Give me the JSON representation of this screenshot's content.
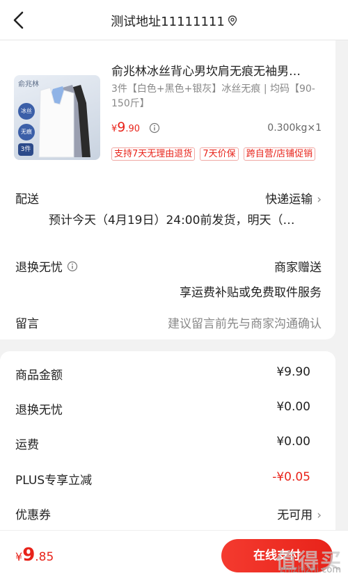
{
  "header": {
    "title": "测试地址11111111",
    "back_icon": "chevron-left-icon",
    "location_icon": "location-pin-icon"
  },
  "product": {
    "title": "俞兆林冰丝背心男坎肩无痕无袖男…",
    "thumb_brand": "俞兆林",
    "thumb_badge1": "冰丝",
    "thumb_badge2": "无痕",
    "thumb_badge3": "3件",
    "spec": "3件【白色+黑色+银灰】冰丝无痕 | 均码【90-150斤】",
    "price_currency": "¥",
    "price_int": "9",
    "price_dec": ".90",
    "weight_qty": "0.300kg×1",
    "tags": [
      "支持7天无理由退货",
      "7天价保",
      "跨自营/店铺促销"
    ]
  },
  "delivery": {
    "label": "配送",
    "value": "快递运输",
    "subtext": "预计今天（4月19日）24:00前发货，明天（…"
  },
  "return_worry_free": {
    "label": "退换无忧",
    "value": "商家赠送",
    "subtext": "享运费补贴或免费取件服务"
  },
  "message": {
    "label": "留言",
    "placeholder": "建议留言前先与商家沟通确认"
  },
  "summary": {
    "rows": [
      {
        "label": "商品金额",
        "value": "¥9.90"
      },
      {
        "label": "退换无忧",
        "value": "¥0.00"
      },
      {
        "label": "运费",
        "value": "¥0.00"
      },
      {
        "label": "PLUS专享立减",
        "value": "-¥0.05"
      },
      {
        "label": "优惠券",
        "value": "无可用"
      }
    ]
  },
  "footer": {
    "total_currency": "¥",
    "total_int": "9",
    "total_dec": ".85",
    "pay_label": "在线支付",
    "watermark": "值得买",
    "watermark_url": "zhizhizhi.com"
  },
  "colors": {
    "accent": "#e8231a",
    "text": "#222222",
    "muted": "#888888",
    "background": "#f2f2f2"
  }
}
